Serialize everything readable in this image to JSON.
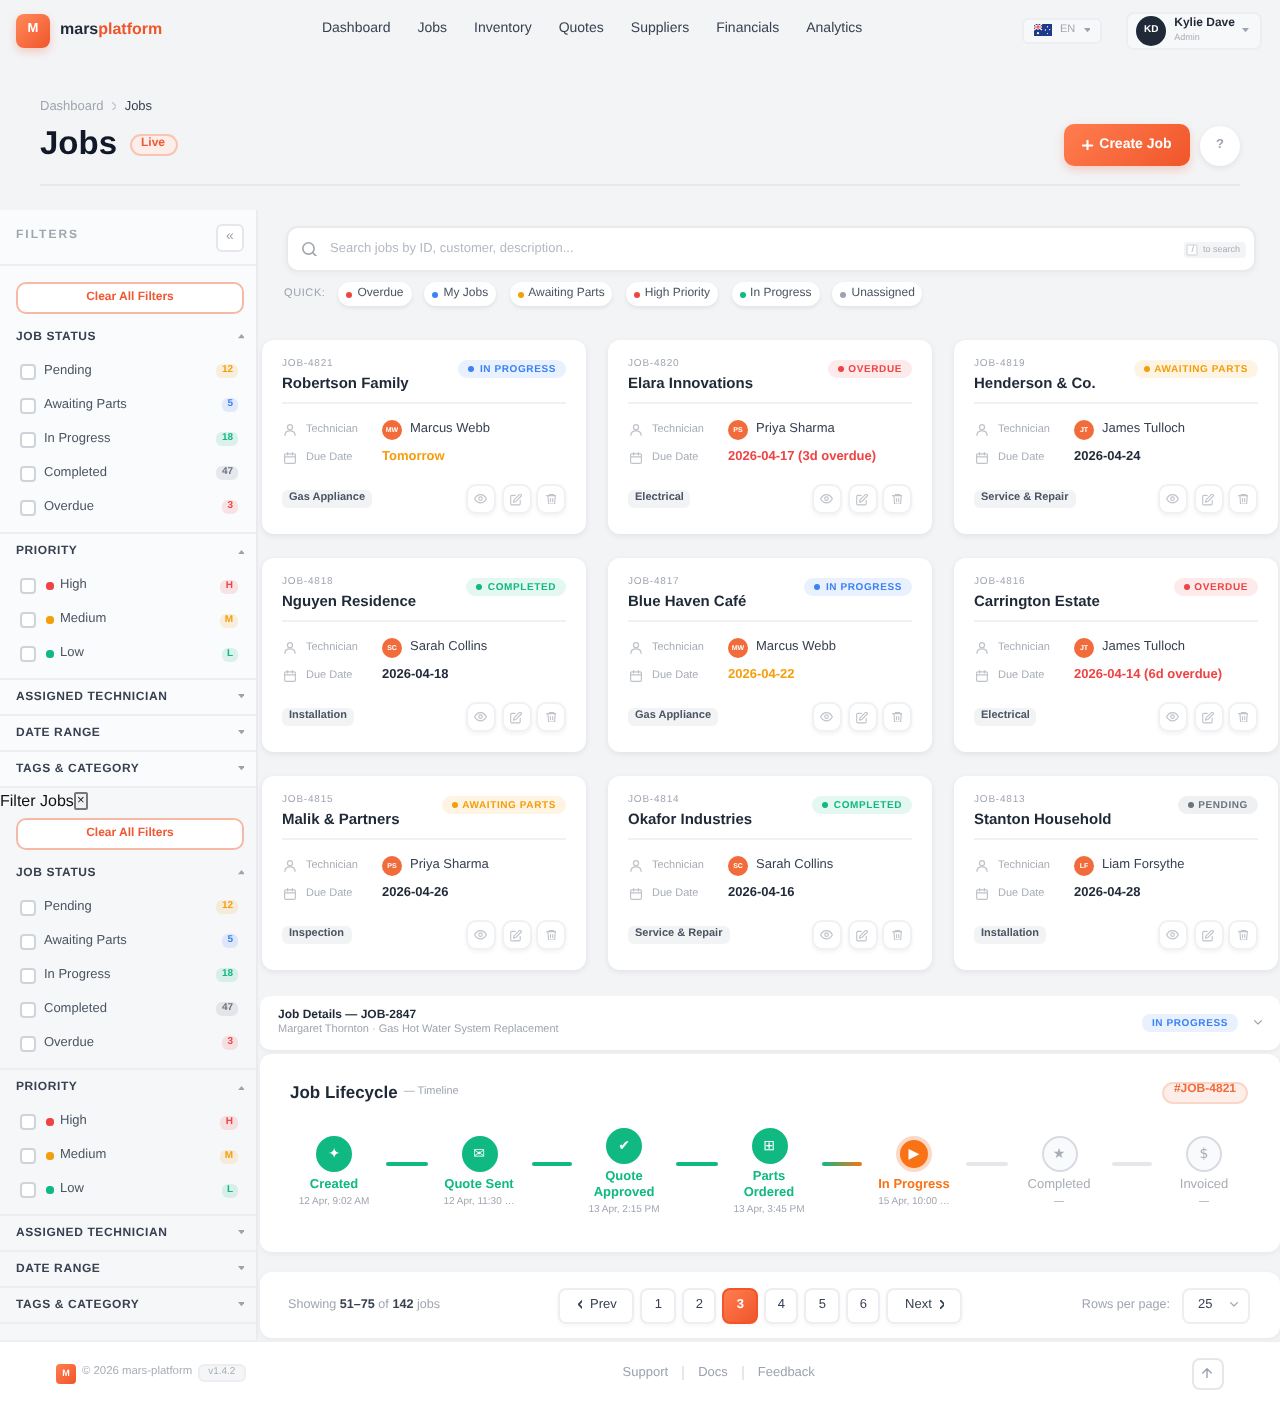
{
  "header": {
    "logo": "M",
    "brand": "mars",
    "brand_accent": "platform",
    "nav": [
      "Dashboard",
      "Jobs",
      "Inventory",
      "Quotes",
      "Suppliers",
      "Financials",
      "Analytics"
    ],
    "language": "EN",
    "user": {
      "initials": "KD",
      "name": "Kylie Dave",
      "role": "Admin"
    }
  },
  "page_header": {
    "breadcrumb": [
      "Dashboard",
      "Jobs"
    ],
    "title": "Jobs",
    "badge": "Live",
    "create_label": "Create Job",
    "help_label": "?"
  },
  "filters": {
    "title": "FILTERS",
    "collapse_label": "«",
    "clear_label": "Clear All Filters",
    "sections": [
      {
        "title": "JOB STATUS",
        "expanded": true,
        "options": [
          {
            "kind": "count",
            "label": "Pending",
            "badge": "12",
            "color": "#f59e0b",
            "checked": false
          },
          {
            "kind": "count",
            "label": "Awaiting Parts",
            "badge": "5",
            "color": "#3b82f6",
            "checked": false
          },
          {
            "kind": "count",
            "label": "In Progress",
            "badge": "18",
            "color": "#10b981",
            "checked": false
          },
          {
            "kind": "count",
            "label": "Completed",
            "badge": "47",
            "color": "#6b7280",
            "checked": false
          },
          {
            "kind": "count",
            "label": "Overdue",
            "badge": "3",
            "color": "#ef4444",
            "checked": false
          }
        ]
      },
      {
        "title": "PRIORITY",
        "expanded": true,
        "options": [
          {
            "kind": "dot",
            "label": "High",
            "badge": "H",
            "color": "#ef4444",
            "checked": false
          },
          {
            "kind": "dot",
            "label": "Medium",
            "badge": "M",
            "color": "#f59e0b",
            "checked": false
          },
          {
            "kind": "dot",
            "label": "Low",
            "badge": "L",
            "color": "#10b981",
            "checked": false
          }
        ]
      },
      {
        "title": "ASSIGNED TECHNICIAN",
        "expanded": false
      },
      {
        "title": "DATE RANGE",
        "expanded": false
      },
      {
        "title": "TAGS & CATEGORY",
        "expanded": false
      }
    ]
  },
  "filter_drawer": {
    "title": "Filter Jobs",
    "close_label": "×",
    "clear_label": "Clear All Filters",
    "sections": [
      {
        "title": "JOB STATUS",
        "expanded": true,
        "options": [
          {
            "kind": "count",
            "label": "Pending",
            "badge": "12",
            "color": "#f59e0b",
            "checked": false
          },
          {
            "kind": "count",
            "label": "Awaiting Parts",
            "badge": "5",
            "color": "#3b82f6",
            "checked": false
          },
          {
            "kind": "count",
            "label": "In Progress",
            "badge": "18",
            "color": "#10b981",
            "checked": false
          },
          {
            "kind": "count",
            "label": "Completed",
            "badge": "47",
            "color": "#6b7280",
            "checked": false
          },
          {
            "kind": "count",
            "label": "Overdue",
            "badge": "3",
            "color": "#ef4444",
            "checked": false
          }
        ]
      },
      {
        "title": "PRIORITY",
        "expanded": true,
        "options": [
          {
            "kind": "dot",
            "label": "High",
            "badge": "H",
            "color": "#ef4444",
            "checked": false
          },
          {
            "kind": "dot",
            "label": "Medium",
            "badge": "M",
            "color": "#f59e0b",
            "checked": false
          },
          {
            "kind": "dot",
            "label": "Low",
            "badge": "L",
            "color": "#10b981",
            "checked": false
          }
        ]
      },
      {
        "title": "ASSIGNED TECHNICIAN",
        "expanded": false
      },
      {
        "title": "DATE RANGE",
        "expanded": false
      },
      {
        "title": "TAGS & CATEGORY",
        "expanded": false
      }
    ]
  },
  "search": {
    "placeholder": "Search jobs by ID, customer, description...",
    "shortcut_key": "/",
    "shortcut_text": "to search"
  },
  "quick_filters": {
    "label": "QUICK:",
    "chips": [
      {
        "label": "Overdue",
        "color": "#ef4444"
      },
      {
        "label": "My Jobs",
        "color": "#3b82f6"
      },
      {
        "label": "Awaiting Parts",
        "color": "#f59e0b"
      },
      {
        "label": "High Priority",
        "color": "#ef4444"
      },
      {
        "label": "In Progress",
        "color": "#10b981"
      },
      {
        "label": "Unassigned",
        "color": "#9ca3af"
      }
    ]
  },
  "cards": [
    {
      "id": "JOB-4821",
      "customer": "Robertson Family",
      "status": {
        "label": "IN PROGRESS",
        "color": "#3b82f6"
      },
      "technician_label": "Technician",
      "technician": {
        "initials": "MW",
        "name": "Marcus Webb"
      },
      "due_label": "Due Date",
      "due": {
        "text": "Tomorrow",
        "color": "#f59e0b"
      },
      "tag": "Gas Appliance"
    },
    {
      "id": "JOB-4820",
      "customer": "Elara Innovations",
      "status": {
        "label": "OVERDUE",
        "color": "#ef4444"
      },
      "technician_label": "Technician",
      "technician": {
        "initials": "PS",
        "name": "Priya Sharma"
      },
      "due_label": "Due Date",
      "due": {
        "text": "2026-04-17 (3d overdue)",
        "color": "#ef4444"
      },
      "tag": "Electrical"
    },
    {
      "id": "JOB-4819",
      "customer": "Henderson & Co.",
      "status": {
        "label": "AWAITING PARTS",
        "color": "#f59e0b"
      },
      "technician_label": "Technician",
      "technician": {
        "initials": "JT",
        "name": "James Tulloch"
      },
      "due_label": "Due Date",
      "due": {
        "text": "2026-04-24",
        "color": "#1f2937"
      },
      "tag": "Service & Repair"
    },
    {
      "id": "JOB-4818",
      "customer": "Nguyen Residence",
      "status": {
        "label": "COMPLETED",
        "color": "#10b981"
      },
      "technician_label": "Technician",
      "technician": {
        "initials": "SC",
        "name": "Sarah Collins"
      },
      "due_label": "Due Date",
      "due": {
        "text": "2026-04-18",
        "color": "#1f2937"
      },
      "tag": "Installation"
    },
    {
      "id": "JOB-4817",
      "customer": "Blue Haven Café",
      "status": {
        "label": "IN PROGRESS",
        "color": "#3b82f6"
      },
      "technician_label": "Technician",
      "technician": {
        "initials": "MW",
        "name": "Marcus Webb"
      },
      "due_label": "Due Date",
      "due": {
        "text": "2026-04-22",
        "color": "#f59e0b"
      },
      "tag": "Gas Appliance"
    },
    {
      "id": "JOB-4816",
      "customer": "Carrington Estate",
      "status": {
        "label": "OVERDUE",
        "color": "#ef4444"
      },
      "technician_label": "Technician",
      "technician": {
        "initials": "JT",
        "name": "James Tulloch"
      },
      "due_label": "Due Date",
      "due": {
        "text": "2026-04-14 (6d overdue)",
        "color": "#ef4444"
      },
      "tag": "Electrical"
    },
    {
      "id": "JOB-4815",
      "customer": "Malik & Partners",
      "status": {
        "label": "AWAITING PARTS",
        "color": "#f59e0b"
      },
      "technician_label": "Technician",
      "technician": {
        "initials": "PS",
        "name": "Priya Sharma"
      },
      "due_label": "Due Date",
      "due": {
        "text": "2026-04-26",
        "color": "#1f2937"
      },
      "tag": "Inspection"
    },
    {
      "id": "JOB-4814",
      "customer": "Okafor Industries",
      "status": {
        "label": "COMPLETED",
        "color": "#10b981"
      },
      "technician_label": "Technician",
      "technician": {
        "initials": "SC",
        "name": "Sarah Collins"
      },
      "due_label": "Due Date",
      "due": {
        "text": "2026-04-16",
        "color": "#1f2937"
      },
      "tag": "Service & Repair"
    },
    {
      "id": "JOB-4813",
      "customer": "Stanton Household",
      "status": {
        "label": "PENDING",
        "color": "#6b7280"
      },
      "technician_label": "Technician",
      "technician": {
        "initials": "LF",
        "name": "Liam Forsythe"
      },
      "due_label": "Due Date",
      "due": {
        "text": "2026-04-28",
        "color": "#1f2937"
      },
      "tag": "Installation"
    }
  ],
  "job_details": {
    "title": "Job Details — JOB-2847",
    "subtitle": "Margaret Thornton · Gas Hot Water System Replacement",
    "status": {
      "label": "IN PROGRESS",
      "color": "#3b82f6"
    },
    "expanded": false
  },
  "lifecycle": {
    "title": "Job Lifecycle",
    "subtitle": "— Timeline",
    "reference": "#JOB-4821",
    "steps": [
      {
        "glyph": "✦",
        "label": "Created",
        "time": "12 Apr, 9:02 AM",
        "done": true,
        "current": false
      },
      {
        "glyph": "✉",
        "label": "Quote Sent",
        "time": "12 Apr, 11:30 …",
        "done": true,
        "current": false
      },
      {
        "glyph": "✔",
        "label": "Quote Approved",
        "time": "13 Apr, 2:15 PM",
        "done": true,
        "current": false
      },
      {
        "glyph": "⊞",
        "label": "Parts Ordered",
        "time": "13 Apr, 3:45 PM",
        "done": true,
        "current": false
      },
      {
        "glyph": "▶",
        "label": "In Progress",
        "time": "15 Apr, 10:00 …",
        "done": false,
        "current": true
      },
      {
        "glyph": "★",
        "label": "Completed",
        "time": "—",
        "done": false,
        "current": false
      },
      {
        "glyph": "$",
        "label": "Invoiced",
        "time": "—",
        "done": false,
        "current": false
      }
    ]
  },
  "pagination": {
    "summary": "Showing **51–75** of **142** jobs",
    "prev_label": "Prev",
    "pages": [
      {
        "label": "1",
        "selected": false
      },
      {
        "label": "2",
        "selected": false
      },
      {
        "label": "3",
        "selected": true
      },
      {
        "label": "4",
        "selected": false
      },
      {
        "label": "5",
        "selected": false
      },
      {
        "label": "6",
        "selected": false
      }
    ],
    "next_label": "Next",
    "rows_label": "Rows per page:",
    "rows_value": "25"
  },
  "footer": {
    "logo": "M",
    "copyright": "© 2026 mars-platform",
    "version": "v1.4.2",
    "links": [
      "Support",
      "Docs",
      "Feedback"
    ]
  }
}
